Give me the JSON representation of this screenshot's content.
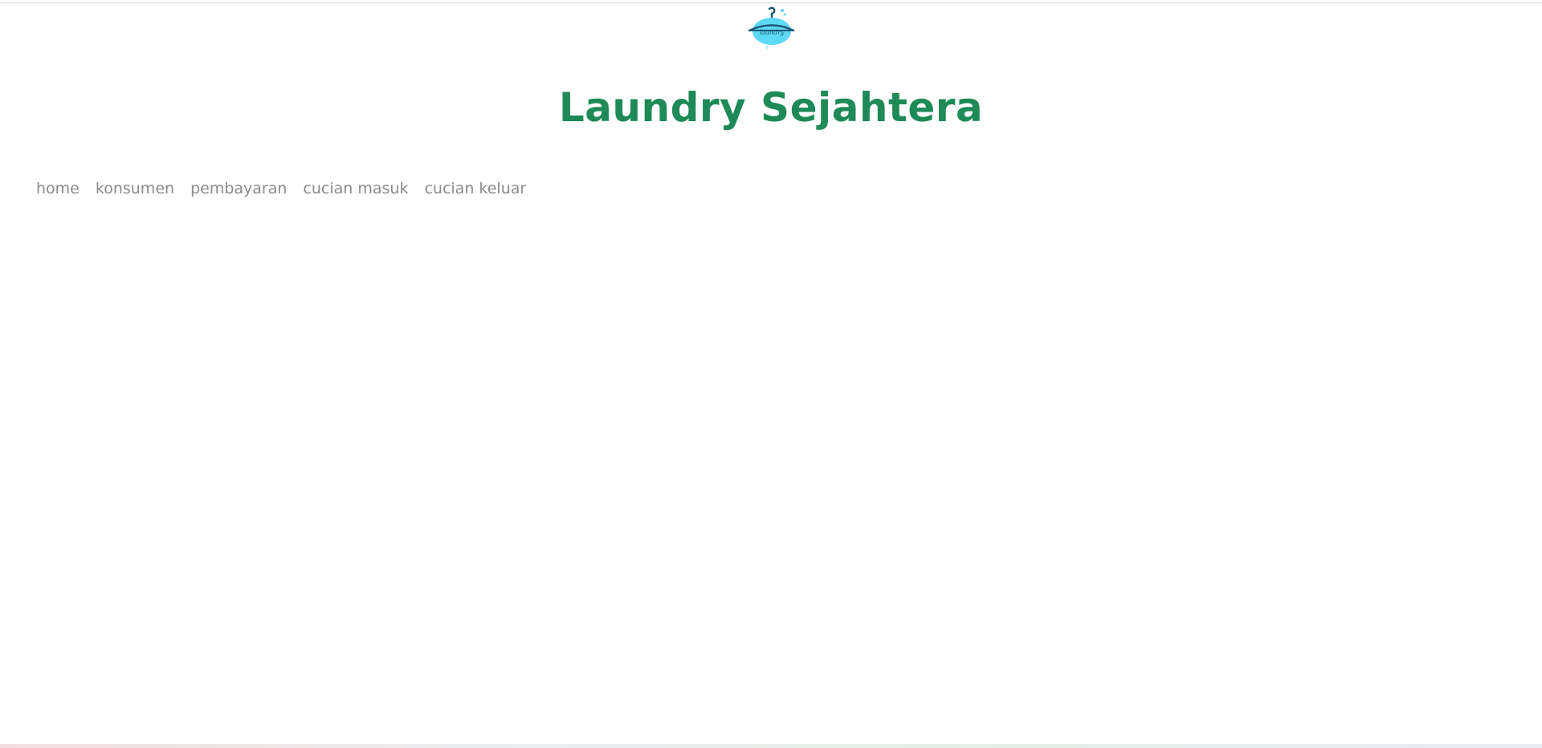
{
  "colors": {
    "title": "#1e8a57",
    "nav_text": "#8a8a8a",
    "logo_blue": "#5dd8f5",
    "logo_dark": "#1b5a78"
  },
  "header": {
    "logo": {
      "icon": "laundry-hanger-logo",
      "text": "laundry"
    },
    "title": "Laundry Sejahtera"
  },
  "nav": {
    "items": [
      {
        "label": "home"
      },
      {
        "label": "konsumen"
      },
      {
        "label": "pembayaran"
      },
      {
        "label": "cucian masuk"
      },
      {
        "label": "cucian keluar"
      }
    ]
  }
}
